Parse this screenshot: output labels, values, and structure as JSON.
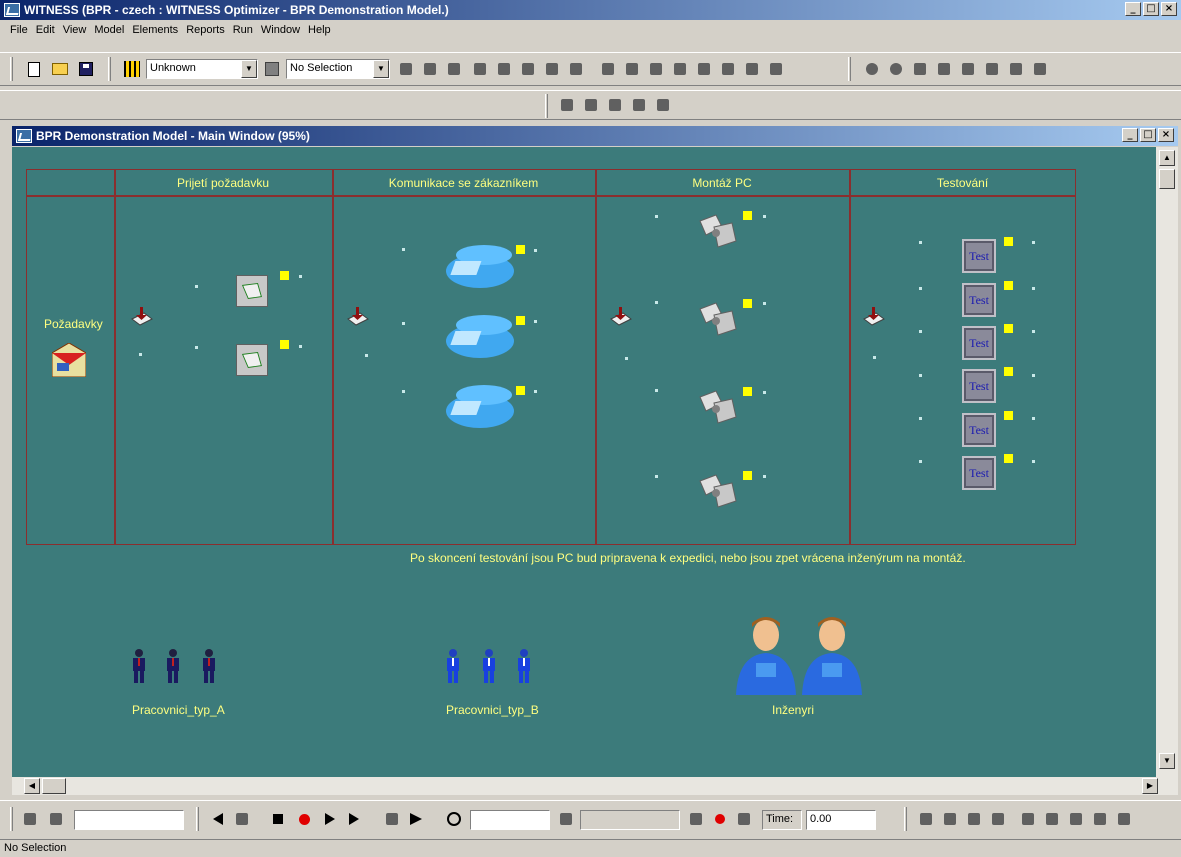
{
  "window": {
    "title": "WITNESS (BPR - czech : WITNESS Optimizer - BPR Demonstration Model.)",
    "min": "_",
    "max": "□",
    "close": "×"
  },
  "menu": [
    "File",
    "Edit",
    "View",
    "Model",
    "Elements",
    "Reports",
    "Run",
    "Window",
    "Help"
  ],
  "toolbar": {
    "element_combo": "Unknown",
    "selection_combo": "No Selection"
  },
  "model_window": {
    "title": "BPR Demonstration Model - Main Window (95%)"
  },
  "lanes": [
    "Prijetí požadavku",
    "Komunikace se zákazníkem",
    "Montáž PC",
    "Testování"
  ],
  "source_label": "Požadavky",
  "test_label": "Test",
  "note": "Po skoncení testování jsou PC bud pripravena k expedici, nebo jsou zpet vrácena inženýrum na montáž.",
  "labour": {
    "type_a": "Pracovnici_typ_A",
    "type_b": "Pracovnici_typ_B",
    "engineers": "Inženyri"
  },
  "runbar": {
    "time_label": "Time:",
    "time_value": "0.00"
  },
  "status": "No Selection",
  "colors": {
    "canvas": "#3c7b7b",
    "lane_border": "#8b2e2e",
    "label_text": "#ffff80",
    "title_bar": "#0a246a"
  },
  "icons": {
    "toolbar": [
      "new-icon",
      "open-icon",
      "save-icon",
      "element-type-icon",
      "zoom-in-icon",
      "zoom-out-icon"
    ],
    "run": [
      "rewind-icon",
      "step-back-icon",
      "stop-icon",
      "record-icon",
      "step-icon",
      "play-icon",
      "fast-forward-icon",
      "clock-icon"
    ]
  }
}
